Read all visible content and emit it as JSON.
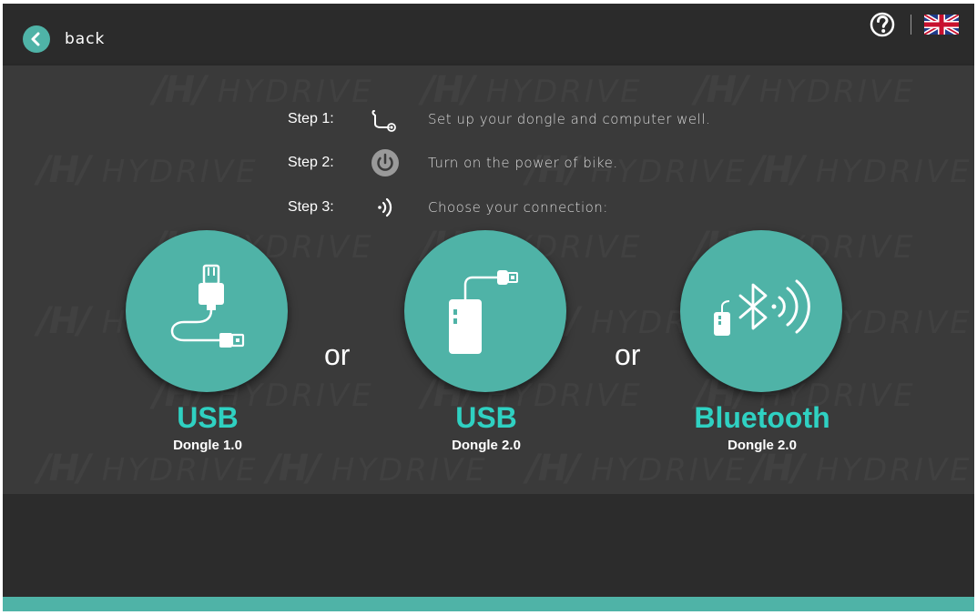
{
  "header": {
    "back_label": "back",
    "icons": {
      "back": "chevron-left-icon",
      "help": "help-icon",
      "language": "uk-flag-icon"
    }
  },
  "watermark": {
    "text": "HYDRIVE"
  },
  "steps": [
    {
      "label": "Step 1:",
      "icon": "cable-icon",
      "text": "Set up your dongle and computer well."
    },
    {
      "label": "Step 2:",
      "icon": "power-icon",
      "text": "Turn on the power of  bike."
    },
    {
      "label": "Step 3:",
      "icon": "wireless-signal-icon",
      "text": "Choose your connection:"
    }
  ],
  "options": [
    {
      "title": "USB",
      "subtitle": "Dongle 1.0",
      "icon": "usb-cable-icon"
    },
    {
      "title": "USB",
      "subtitle": "Dongle 2.0",
      "icon": "usb-dongle-box-icon"
    },
    {
      "title": "Bluetooth",
      "subtitle": "Dongle 2.0",
      "icon": "bluetooth-icon"
    }
  ],
  "separator_text": "or",
  "colors": {
    "accent": "#4fb3a7",
    "accent_text": "#2fd1c2",
    "panel": "#3a3a3a",
    "background": "#2e2e2e"
  }
}
